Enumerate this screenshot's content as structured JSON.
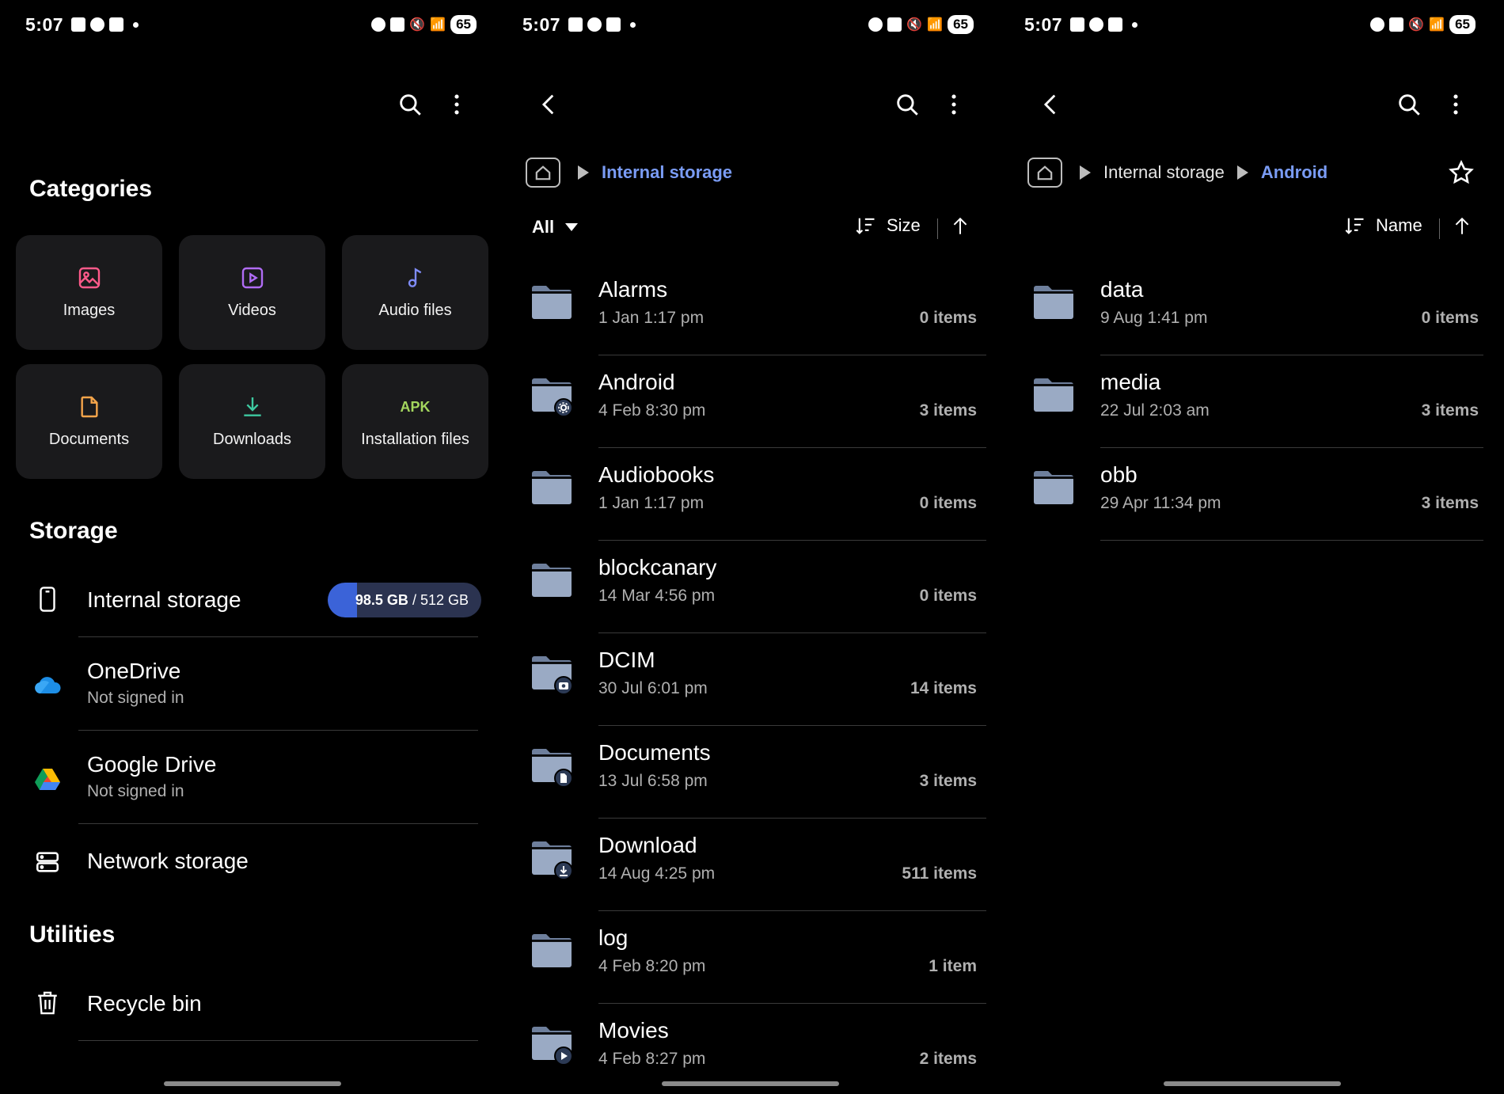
{
  "status_bar": {
    "time": "5:07",
    "battery": "65"
  },
  "panel1": {
    "categories_title": "Categories",
    "categories": [
      {
        "label": "Images",
        "icon": "image-icon",
        "color": "#ff5a8a"
      },
      {
        "label": "Videos",
        "icon": "video-icon",
        "color": "#b06cf5"
      },
      {
        "label": "Audio files",
        "icon": "music-note-icon",
        "color": "#7f8cf7"
      },
      {
        "label": "Documents",
        "icon": "document-icon",
        "color": "#f5a54a"
      },
      {
        "label": "Downloads",
        "icon": "download-icon",
        "color": "#3ec9a0"
      },
      {
        "label": "Installation files",
        "icon": "apk-icon",
        "icon_text": "APK",
        "color": "#a4d65e"
      }
    ],
    "storage_title": "Storage",
    "internal_storage": {
      "label": "Internal storage",
      "used": "98.5 GB",
      "total": "512 GB",
      "used_fraction": 0.19
    },
    "onedrive": {
      "label": "OneDrive",
      "sub": "Not signed in"
    },
    "gdrive": {
      "label": "Google Drive",
      "sub": "Not signed in"
    },
    "network": {
      "label": "Network storage"
    },
    "utilities_title": "Utilities",
    "recycle": {
      "label": "Recycle bin"
    }
  },
  "panel2": {
    "breadcrumb": [
      "Internal storage"
    ],
    "filter": "All",
    "sort": "Size",
    "files": [
      {
        "name": "Alarms",
        "date": "1 Jan 1:17 pm",
        "count": "0 items",
        "badge": ""
      },
      {
        "name": "Android",
        "date": "4 Feb 8:30 pm",
        "count": "3 items",
        "badge": "gear"
      },
      {
        "name": "Audiobooks",
        "date": "1 Jan 1:17 pm",
        "count": "0 items",
        "badge": ""
      },
      {
        "name": "blockcanary",
        "date": "14 Mar 4:56 pm",
        "count": "0 items",
        "badge": ""
      },
      {
        "name": "DCIM",
        "date": "30 Jul 6:01 pm",
        "count": "14 items",
        "badge": "camera"
      },
      {
        "name": "Documents",
        "date": "13 Jul 6:58 pm",
        "count": "3 items",
        "badge": "doc"
      },
      {
        "name": "Download",
        "date": "14 Aug 4:25 pm",
        "count": "511 items",
        "badge": "download"
      },
      {
        "name": "log",
        "date": "4 Feb 8:20 pm",
        "count": "1 item",
        "badge": ""
      },
      {
        "name": "Movies",
        "date": "4 Feb 8:27 pm",
        "count": "2 items",
        "badge": "play"
      }
    ]
  },
  "panel3": {
    "breadcrumb": [
      "Internal storage",
      "Android"
    ],
    "sort": "Name",
    "files": [
      {
        "name": "data",
        "date": "9 Aug 1:41 pm",
        "count": "0 items"
      },
      {
        "name": "media",
        "date": "22 Jul 2:03 am",
        "count": "3 items"
      },
      {
        "name": "obb",
        "date": "29 Apr 11:34 pm",
        "count": "3 items"
      }
    ]
  },
  "colors": {
    "accent": "#7a9cf5",
    "folder": "#9aaac4",
    "folder_dark": "#6e7f9c",
    "card": "#1a1a1c"
  }
}
